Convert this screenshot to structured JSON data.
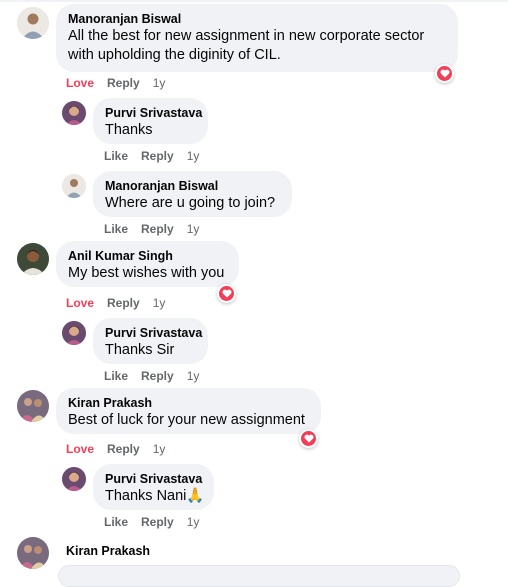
{
  "colors": {
    "love": "#f33e58",
    "meta": "#65676b",
    "bubble": "#f0f2f5"
  },
  "comments": [
    {
      "author": "Manoranjan Biswal",
      "text_line1": "All the best for new assignment in new corporate sector",
      "text_line2": "with upholding the diginity of CIL.",
      "action1": "Love",
      "action2": "Reply",
      "time": "1y",
      "reaction_icon": "heart-icon"
    },
    {
      "author": "Purvi Srivastava",
      "text": "Thanks",
      "action1": "Like",
      "action2": "Reply",
      "time": "1y"
    },
    {
      "author": "Manoranjan Biswal",
      "text": "Where are u going to join?",
      "action1": "Like",
      "action2": "Reply",
      "time": "1y"
    },
    {
      "author": "Anil Kumar Singh",
      "text": "My best wishes with you",
      "action1": "Love",
      "action2": "Reply",
      "time": "1y",
      "reaction_icon": "heart-icon"
    },
    {
      "author": "Purvi Srivastava",
      "text": "Thanks Sir",
      "action1": "Like",
      "action2": "Reply",
      "time": "1y"
    },
    {
      "author": "Kiran Prakash",
      "text": "Best of luck for your new assignment",
      "action1": "Love",
      "action2": "Reply",
      "time": "1y",
      "reaction_icon": "heart-icon"
    },
    {
      "author": "Purvi Srivastava",
      "text": "Thanks Nani🙏",
      "action1": "Like",
      "action2": "Reply",
      "time": "1y"
    },
    {
      "author": "Kiran Prakash"
    }
  ]
}
